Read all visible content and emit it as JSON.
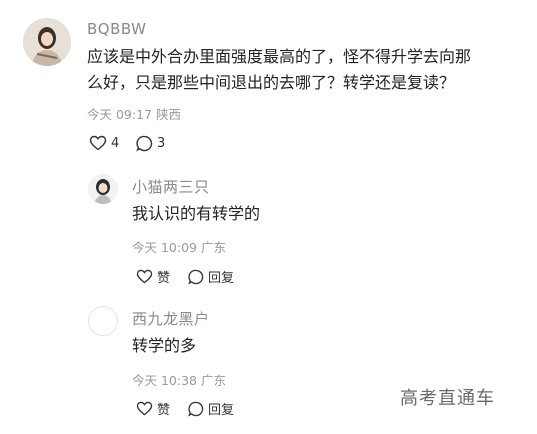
{
  "post": {
    "username": "BQBBW",
    "content_line1": "应该是中外合办里面强度最高的了，怪不得升学去向那",
    "content_line2": "么好，只是那些中间退出的去哪了？转学还是复读？",
    "time": "今天 09:17",
    "location": "陕西",
    "likes": "4",
    "comments": "3"
  },
  "replies": [
    {
      "username": "小猫两三只",
      "content": "我认识的有转学的",
      "time": "今天 10:09",
      "location": "广东",
      "like_label": "赞",
      "reply_label": "回复"
    },
    {
      "username": "西九龙黑户",
      "content": "转学的多",
      "time": "今天 10:38",
      "location": "广东",
      "like_label": "赞",
      "reply_label": "回复"
    }
  ],
  "watermark": "高考直通车",
  "icons": [
    "heart-icon",
    "comment-icon"
  ]
}
